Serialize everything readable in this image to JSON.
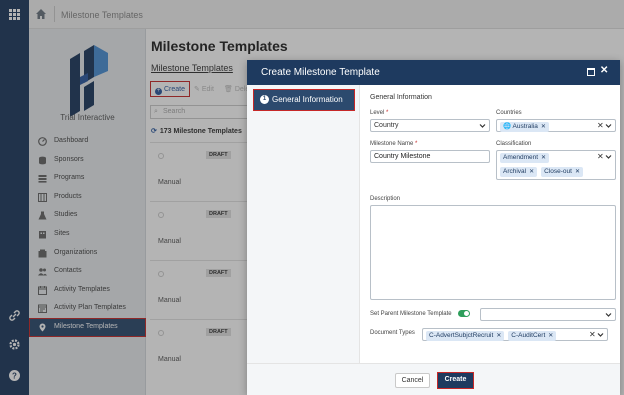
{
  "topbar": {
    "breadcrumb": "Milestone Templates"
  },
  "sidebar": {
    "brand": "Trial Interactive",
    "items": [
      {
        "label": "Dashboard",
        "icon": "dashboard-icon"
      },
      {
        "label": "Sponsors",
        "icon": "sponsors-icon"
      },
      {
        "label": "Programs",
        "icon": "programs-icon"
      },
      {
        "label": "Products",
        "icon": "products-icon"
      },
      {
        "label": "Studies",
        "icon": "studies-icon"
      },
      {
        "label": "Sites",
        "icon": "sites-icon"
      },
      {
        "label": "Organizations",
        "icon": "organizations-icon"
      },
      {
        "label": "Contacts",
        "icon": "contacts-icon"
      },
      {
        "label": "Activity Templates",
        "icon": "activity-templates-icon"
      },
      {
        "label": "Activity Plan Templates",
        "icon": "activity-plan-templates-icon"
      },
      {
        "label": "Milestone Templates",
        "icon": "milestone-templates-icon",
        "active": true
      }
    ]
  },
  "main": {
    "title": "Milestone Templates",
    "subtitle": "Milestone Templates",
    "toolbar": {
      "create": "Create",
      "edit": "Edit",
      "delete": "Dele"
    },
    "search_placeholder": "Search",
    "count": "173 Milestone Templates",
    "cards": [
      {
        "badge": "DRAFT",
        "type": "Manual"
      },
      {
        "badge": "DRAFT",
        "type": "Manual"
      },
      {
        "badge": "DRAFT",
        "type": "Manual"
      },
      {
        "badge": "DRAFT",
        "type": "Manual"
      }
    ]
  },
  "modal": {
    "title": "Create Milestone Template",
    "nav": [
      {
        "num": "1",
        "label": "General Information"
      }
    ],
    "section": "General Information",
    "level_label": "Level",
    "level_value": "Country",
    "countries_label": "Countries",
    "countries": [
      "Australia"
    ],
    "milestone_name_label": "Milestone Name",
    "milestone_name_value": "Country Milestone",
    "classification_label": "Classification",
    "classification": [
      "Amendment",
      "Archival",
      "Close-out"
    ],
    "description_label": "Description",
    "parent_label": "Set Parent Milestone Template",
    "doc_types_label": "Document Types",
    "doc_types": [
      "C-AdvertSubjctRecruit",
      "C-AuditCert"
    ],
    "cancel": "Cancel",
    "create": "Create"
  },
  "colors": {
    "primary": "#1e3a5f",
    "highlight": "#c62828",
    "toggle": "#2e9e5b",
    "tag": "#dbe7f5"
  }
}
